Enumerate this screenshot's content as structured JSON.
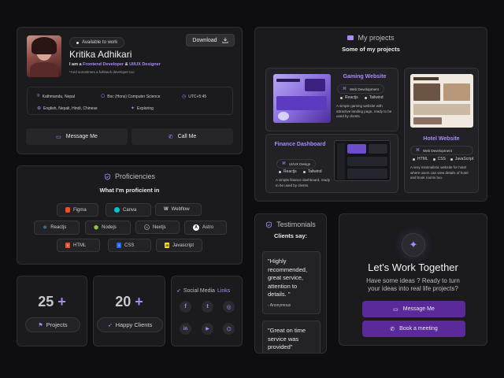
{
  "profile": {
    "available": "Available to work",
    "download": "Download",
    "name": "Kritika Adhikari",
    "role_prefix": "I am a",
    "role_1": "Frontend Developer",
    "role_amp": "&",
    "role_2": "UI/UX Designer",
    "tagline": "*And sometimes a fullstack developer too",
    "info": [
      {
        "icon": "map-pin-icon",
        "text": "Kathmandu, Nepal"
      },
      {
        "icon": "graduation-cap-icon",
        "text": "Bsc (Hons) Computer Science"
      },
      {
        "icon": "clock-icon",
        "text": "UTC+5:45"
      },
      {
        "icon": "globe-icon",
        "text": "English, Nepali, Hindi, Chinese"
      },
      {
        "icon": "sparkle-icon",
        "text": "Exploring"
      }
    ],
    "message_btn": "Message Me",
    "call_btn": "Call Me"
  },
  "proficiencies": {
    "title": "Proficiencies",
    "subtitle": "What I'm proficient in",
    "rows": [
      [
        {
          "label": "Figma",
          "color": "#f24e1e"
        },
        {
          "label": "Canva",
          "color": "#00c4cc"
        },
        {
          "label": "Webflow",
          "color": "#ffffff"
        }
      ],
      [
        {
          "label": "Reactjs",
          "color": "#61dafb"
        },
        {
          "label": "Nodejs",
          "color": "#8cc84b"
        },
        {
          "label": "Nextjs",
          "color": "#ffffff"
        },
        {
          "label": "Astro",
          "color": "#ffffff"
        }
      ],
      [
        {
          "label": "HTML",
          "color": "#e34f26"
        },
        {
          "label": "CSS",
          "color": "#2965f1"
        },
        {
          "label": "Javascript",
          "color": "#f7df1e"
        }
      ]
    ]
  },
  "stats": [
    {
      "value": "25",
      "plus": "+",
      "label": "Projects"
    },
    {
      "value": "20",
      "plus": "+",
      "label": "Happy Clients"
    }
  ],
  "social": {
    "title_1": "Social Media",
    "title_2": "Links",
    "icons": [
      "facebook-icon",
      "twitter-icon",
      "instagram-icon",
      "linkedin-icon",
      "youtube-icon",
      "github-icon"
    ],
    "glyphs": [
      "f",
      "t",
      "◎",
      "in",
      "▶",
      "⌬"
    ]
  },
  "projects": {
    "title": "My projects",
    "subtitle": "Some of my projects",
    "gaming": {
      "title": "Gaming Website",
      "category": "Web Development",
      "tags": [
        "Reactjs",
        "Tailwind"
      ],
      "desc": "A simple gaming website with attractive landing page, ready to be used by clients."
    },
    "finance": {
      "title": "Finance Dashboard",
      "category": "UI/UX Design",
      "tags": [
        "Reactjs",
        "Tailwind"
      ],
      "desc": "A simple finance dashboard, ready to be used by clients."
    },
    "hotel": {
      "title": "Hotel Website",
      "category": "Web Development",
      "tags": [
        "HTML",
        "CSS",
        "JavaScript"
      ],
      "desc": "A very minimalistic website for hotel where users can view details of hotel and book rooms too."
    }
  },
  "testimonials": {
    "title": "Testimonials",
    "subtitle": "Clients say:",
    "items": [
      {
        "quote": "\"Highly recommended, great service, attention to details. \"",
        "author": "- Anonymous"
      },
      {
        "quote": "\"Great on time service was provided\"",
        "author": ""
      }
    ]
  },
  "cta": {
    "title": "Let's Work Together",
    "line1": "Have some ideas ? Ready to turn",
    "line2": "your ideas into real life projects?",
    "message_btn": "Message Me",
    "meeting_btn": "Book a meeting"
  },
  "colors": {
    "accent": "#a78bfa",
    "button_purple": "#5b2a9a",
    "card_bg": "#1b1b1e"
  }
}
